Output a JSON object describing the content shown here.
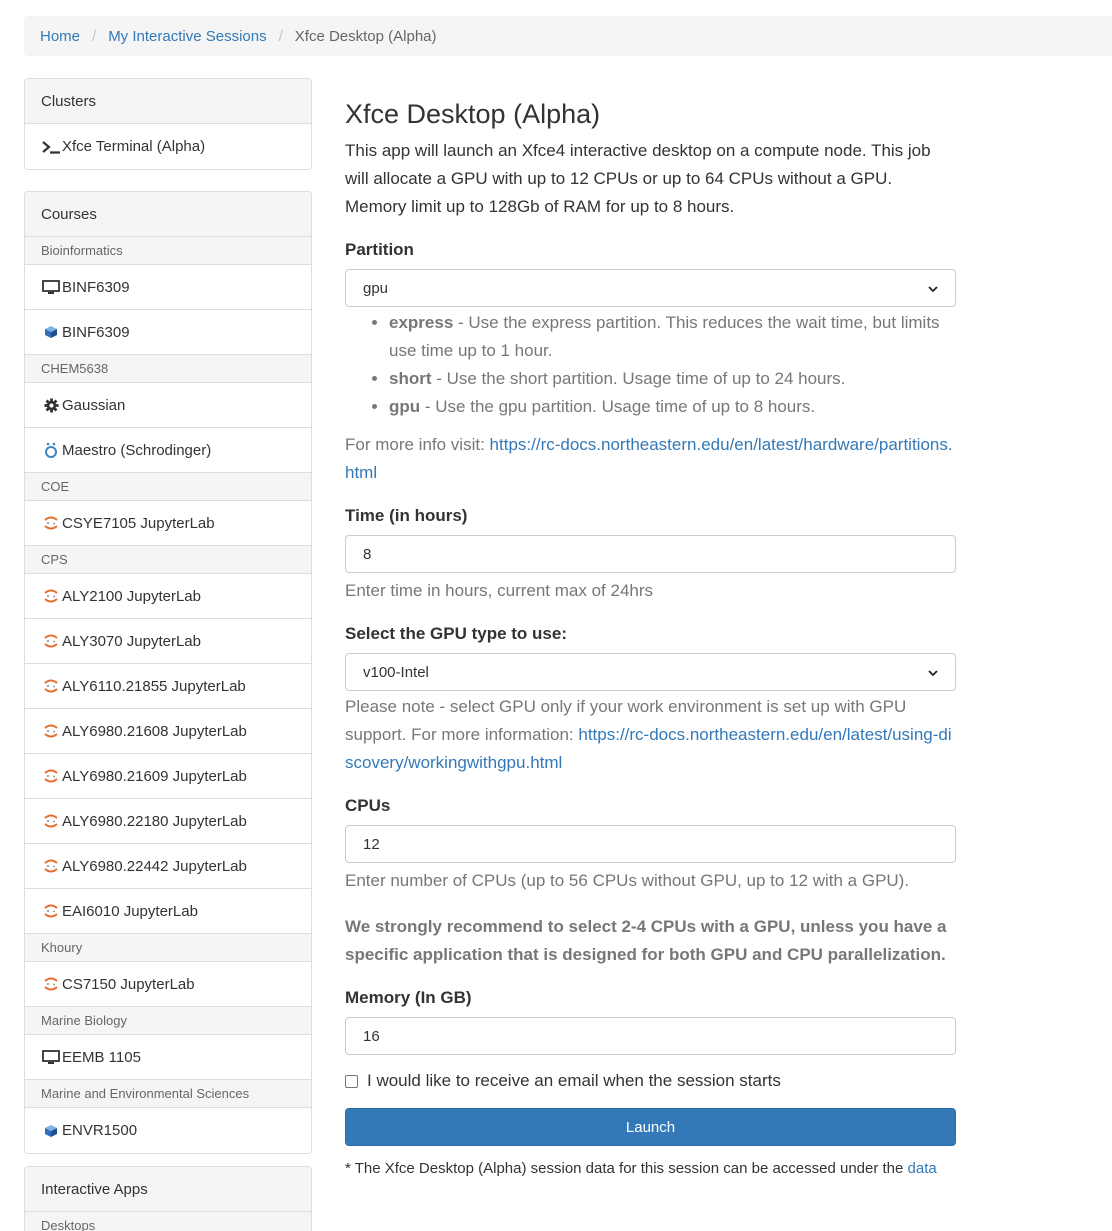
{
  "breadcrumb": {
    "home": "Home",
    "sessions": "My Interactive Sessions",
    "current": "Xfce Desktop (Alpha)"
  },
  "clusters": {
    "heading": "Clusters",
    "items": [
      {
        "icon": "terminal-icon",
        "label": "Xfce Terminal (Alpha)"
      }
    ]
  },
  "courses": {
    "heading": "Courses",
    "groups": [
      {
        "title": "Bioinformatics",
        "items": [
          {
            "icon": "desktop-icon",
            "label": "BINF6309"
          },
          {
            "icon": "cube-icon",
            "label": "BINF6309"
          }
        ]
      },
      {
        "title": "CHEM5638",
        "items": [
          {
            "icon": "gear-icon",
            "label": "Gaussian"
          },
          {
            "icon": "maestro-icon",
            "label": "Maestro (Schrodinger)"
          }
        ]
      },
      {
        "title": "COE",
        "items": [
          {
            "icon": "jupyter-icon",
            "label": "CSYE7105 JupyterLab"
          }
        ]
      },
      {
        "title": "CPS",
        "items": [
          {
            "icon": "jupyter-icon",
            "label": "ALY2100 JupyterLab"
          },
          {
            "icon": "jupyter-icon",
            "label": "ALY3070 JupyterLab"
          },
          {
            "icon": "jupyter-icon",
            "label": "ALY6110.21855 JupyterLab"
          },
          {
            "icon": "jupyter-icon",
            "label": "ALY6980.21608 JupyterLab"
          },
          {
            "icon": "jupyter-icon",
            "label": "ALY6980.21609 JupyterLab"
          },
          {
            "icon": "jupyter-icon",
            "label": "ALY6980.22180 JupyterLab"
          },
          {
            "icon": "jupyter-icon",
            "label": "ALY6980.22442 JupyterLab"
          },
          {
            "icon": "jupyter-icon",
            "label": "EAI6010 JupyterLab"
          }
        ]
      },
      {
        "title": "Khoury",
        "items": [
          {
            "icon": "jupyter-icon",
            "label": "CS7150 JupyterLab"
          }
        ]
      },
      {
        "title": "Marine Biology",
        "items": [
          {
            "icon": "desktop-icon",
            "label": "EEMB 1105"
          }
        ]
      },
      {
        "title": "Marine and Environmental Sciences",
        "items": [
          {
            "icon": "cube-icon",
            "label": "ENVR1500"
          }
        ]
      }
    ]
  },
  "interactive_apps": {
    "heading": "Interactive Apps",
    "groups": [
      {
        "title": "Desktops"
      }
    ]
  },
  "form": {
    "title": "Xfce Desktop (Alpha)",
    "description": "This app will launch an Xfce4 interactive desktop on a compute node. This job will allocate a GPU with up to 12 CPUs or up to 64 CPUs without a GPU. Memory limit up to 128Gb of RAM for up to 8 hours.",
    "partition": {
      "label": "Partition",
      "value": "gpu",
      "options": [
        {
          "name": "express",
          "desc": " - Use the express partition. This reduces the wait time, but limits use time up to 1 hour."
        },
        {
          "name": "short",
          "desc": " - Use the short partition. Usage time of up to 24 hours."
        },
        {
          "name": "gpu",
          "desc": " - Use the gpu partition. Usage time of up to 8 hours."
        }
      ],
      "info_prefix": "For more info visit: ",
      "info_link": "https://rc-docs.northeastern.edu/en/latest/hardware/partitions.html"
    },
    "time": {
      "label": "Time (in hours)",
      "value": "8",
      "help": "Enter time in hours, current max of 24hrs"
    },
    "gpu": {
      "label": "Select the GPU type to use:",
      "value": "v100-Intel",
      "help_prefix": "Please note - select GPU only if your work environment is set up with GPU support. For more information: ",
      "help_link": "https://rc-docs.northeastern.edu/en/latest/using-discovery/workingwithgpu.html"
    },
    "cpus": {
      "label": "CPUs",
      "value": "12",
      "help": "Enter number of CPUs (up to 56 CPUs without GPU, up to 12 with a GPU).",
      "recommendation": "We strongly recommend to select 2-4 CPUs with a GPU, unless you have a specific application that is designed for both GPU and CPU parallelization."
    },
    "memory": {
      "label": "Memory (In GB)",
      "value": "16"
    },
    "email_label": "I would like to receive an email when the session starts",
    "launch_label": "Launch",
    "footnote_prefix": "* The Xfce Desktop (Alpha) session data for this session can be accessed under the ",
    "footnote_link": "data"
  },
  "colors": {
    "link": "#3379b7",
    "primary_button": "#3379b7",
    "panel_heading_bg": "#f5f5f5",
    "border": "#dddddd",
    "muted_text": "#777777"
  }
}
